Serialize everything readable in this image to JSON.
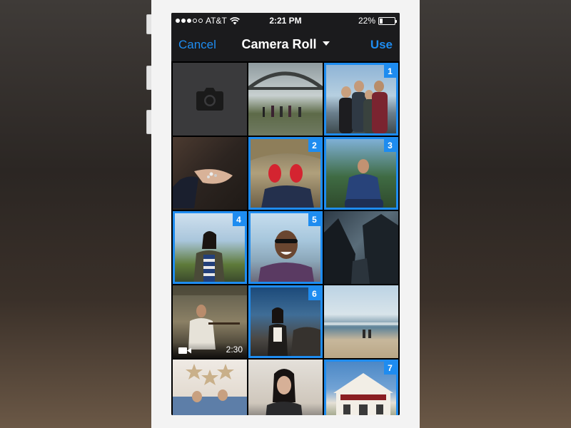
{
  "status_bar": {
    "carrier": "AT&T",
    "time": "2:21 PM",
    "battery_percent": "22%",
    "battery_level": 0.22
  },
  "nav": {
    "cancel_label": "Cancel",
    "title": "Camera Roll",
    "use_label": "Use"
  },
  "grid": {
    "tiles": [
      {
        "kind": "camera",
        "selected": false,
        "badge": ""
      },
      {
        "kind": "photo",
        "selected": false,
        "badge": ""
      },
      {
        "kind": "photo",
        "selected": true,
        "badge": "1"
      },
      {
        "kind": "photo",
        "selected": false,
        "badge": ""
      },
      {
        "kind": "photo",
        "selected": true,
        "badge": "2"
      },
      {
        "kind": "photo",
        "selected": true,
        "badge": "3"
      },
      {
        "kind": "photo",
        "selected": true,
        "badge": "4"
      },
      {
        "kind": "photo",
        "selected": true,
        "badge": "5"
      },
      {
        "kind": "photo",
        "selected": false,
        "badge": ""
      },
      {
        "kind": "video",
        "selected": false,
        "badge": "",
        "duration": "2:30"
      },
      {
        "kind": "photo",
        "selected": true,
        "badge": "6"
      },
      {
        "kind": "photo",
        "selected": false,
        "badge": ""
      },
      {
        "kind": "photo",
        "selected": false,
        "badge": ""
      },
      {
        "kind": "photo",
        "selected": false,
        "badge": ""
      },
      {
        "kind": "photo",
        "selected": true,
        "badge": "7"
      }
    ]
  },
  "colors": {
    "accent": "#1e8cf0",
    "bar_background": "#1b1b1d",
    "camera_tile": "#3a3a3c"
  },
  "icons": {
    "camera": "camera-icon",
    "video": "video-camera-icon",
    "wifi": "wifi-icon",
    "battery": "battery-icon",
    "dropdown": "caret-down-icon"
  }
}
